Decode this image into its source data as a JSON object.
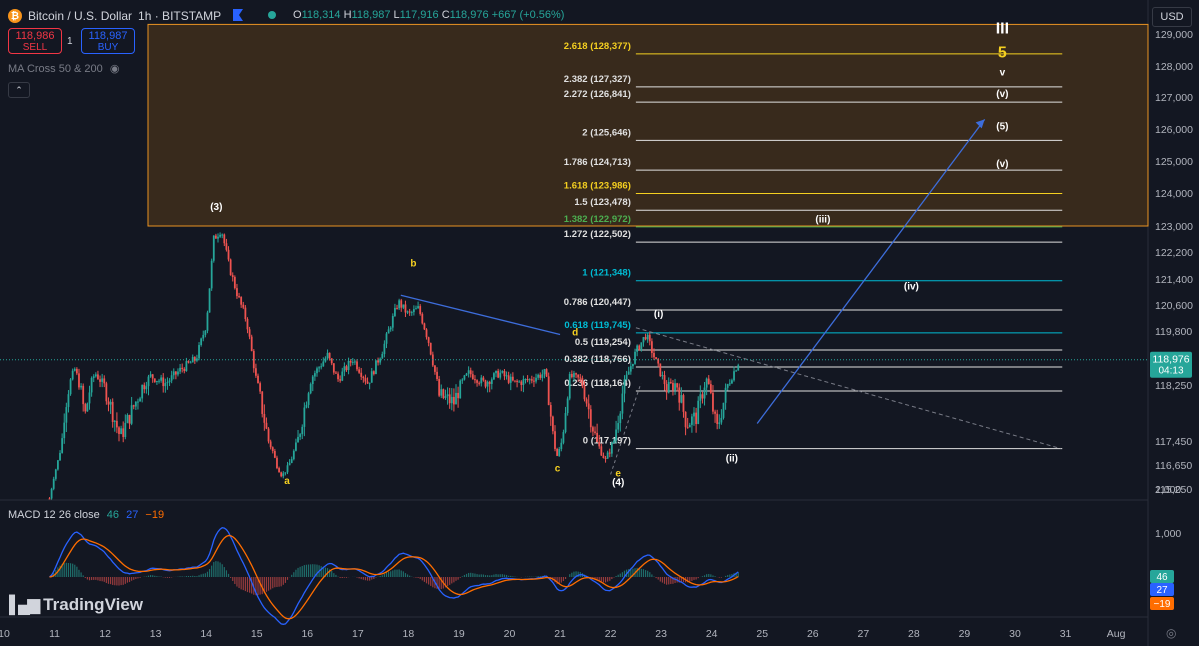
{
  "header": {
    "symbol": "Bitcoin / U.S. Dollar",
    "interval_exchange": "1h · BITSTAMP",
    "ohlc": [
      {
        "k": "O",
        "v": "118,314"
      },
      {
        "k": "H",
        "v": "118,987"
      },
      {
        "k": "L",
        "v": "117,916"
      },
      {
        "k": "C",
        "v": "118,976"
      }
    ],
    "change": "+667 (+0.56%)",
    "sell_price": "118,986",
    "sell_label": "SELL",
    "buy_price": "118,987",
    "buy_label": "BUY",
    "spread": "1",
    "indicator": "MA Cross 50 & 200",
    "macd_label": "MACD 12 26 close",
    "macd_values": [
      "46",
      "27",
      "−19"
    ],
    "currency": "USD",
    "logo": "TradingView",
    "icons": [
      "bitcoin-icon",
      "flag-icon",
      "status-dot-icon",
      "eye-icon",
      "collapse-icon",
      "gear-icon"
    ]
  },
  "colors": {
    "bg": "#131722",
    "up": "#26a69a",
    "down": "#ef5350",
    "fib_white": "#e0e0e0",
    "fib_yellow": "#f5d020",
    "fib_green": "#4caf50",
    "fib_cyan": "#00bcd4",
    "box": "#3a2c1c",
    "box_border": "#f59a23",
    "trend": "#3d6ddb",
    "macd": "#2962ff",
    "signal": "#ff6d00",
    "wave_yellow": "#f5d020"
  },
  "chart_data": {
    "type": "candlestick",
    "title": "Bitcoin / U.S. Dollar",
    "ylim": [
      114700,
      129300
    ],
    "y_ticks": [
      115250,
      116650,
      117450,
      118250,
      119800,
      120600,
      121400,
      122200,
      123000,
      124000,
      125000,
      126000,
      127000,
      128000,
      129000
    ],
    "x_ticks": [
      {
        "label": "10",
        "day": 10
      },
      {
        "label": "11",
        "day": 11
      },
      {
        "label": "12",
        "day": 12
      },
      {
        "label": "13",
        "day": 13
      },
      {
        "label": "14",
        "day": 14
      },
      {
        "label": "15",
        "day": 15
      },
      {
        "label": "16",
        "day": 16
      },
      {
        "label": "17",
        "day": 17
      },
      {
        "label": "18",
        "day": 18
      },
      {
        "label": "19",
        "day": 19
      },
      {
        "label": "20",
        "day": 20
      },
      {
        "label": "21",
        "day": 21
      },
      {
        "label": "22",
        "day": 22
      },
      {
        "label": "23",
        "day": 23
      },
      {
        "label": "24",
        "day": 24
      },
      {
        "label": "25",
        "day": 25
      },
      {
        "label": "26",
        "day": 26
      },
      {
        "label": "27",
        "day": 27
      },
      {
        "label": "28",
        "day": 28
      },
      {
        "label": "29",
        "day": 29
      },
      {
        "label": "30",
        "day": 30
      },
      {
        "label": "31",
        "day": 31
      },
      {
        "label": "Aug",
        "day": 32
      }
    ],
    "last_price": "118,976",
    "countdown": "04:13",
    "price_path": [
      [
        10.9,
        114700
      ],
      [
        11.0,
        116200
      ],
      [
        11.2,
        117900
      ],
      [
        11.4,
        118700
      ],
      [
        11.6,
        117800
      ],
      [
        11.8,
        118600
      ],
      [
        12.0,
        118200
      ],
      [
        12.3,
        117500
      ],
      [
        12.6,
        118000
      ],
      [
        12.9,
        118500
      ],
      [
        13.2,
        118300
      ],
      [
        13.5,
        118700
      ],
      [
        13.8,
        119000
      ],
      [
        14.0,
        120000
      ],
      [
        14.15,
        122600
      ],
      [
        14.3,
        122900
      ],
      [
        14.45,
        121800
      ],
      [
        14.6,
        121000
      ],
      [
        14.8,
        120100
      ],
      [
        15.0,
        118300
      ],
      [
        15.3,
        117200
      ],
      [
        15.5,
        116000
      ],
      [
        15.8,
        117400
      ],
      [
        16.1,
        118500
      ],
      [
        16.4,
        119100
      ],
      [
        16.6,
        118400
      ],
      [
        16.9,
        119000
      ],
      [
        17.2,
        118300
      ],
      [
        17.5,
        119300
      ],
      [
        17.8,
        120700
      ],
      [
        18.0,
        120300
      ],
      [
        18.2,
        120500
      ],
      [
        18.4,
        119500
      ],
      [
        18.6,
        118100
      ],
      [
        18.9,
        118000
      ],
      [
        19.2,
        118600
      ],
      [
        19.5,
        118300
      ],
      [
        19.8,
        118600
      ],
      [
        20.1,
        118300
      ],
      [
        20.4,
        118400
      ],
      [
        20.7,
        118600
      ],
      [
        20.95,
        116900
      ],
      [
        21.2,
        118500
      ],
      [
        21.4,
        118400
      ],
      [
        21.7,
        117500
      ],
      [
        21.9,
        116800
      ],
      [
        22.1,
        117600
      ],
      [
        22.3,
        118400
      ],
      [
        22.5,
        119200
      ],
      [
        22.7,
        119700
      ],
      [
        22.9,
        118900
      ],
      [
        23.1,
        118200
      ],
      [
        23.3,
        118300
      ],
      [
        23.5,
        117700
      ],
      [
        23.7,
        117800
      ],
      [
        23.9,
        118400
      ],
      [
        24.1,
        117600
      ],
      [
        24.3,
        118200
      ],
      [
        24.55,
        118976
      ]
    ],
    "fib_levels": [
      {
        "label": "2.618 (128,377)",
        "value": 128377,
        "color": "yellow"
      },
      {
        "label": "2.382 (127,327)",
        "value": 127327,
        "color": "white"
      },
      {
        "label": "2.272 (126,841)",
        "value": 126841,
        "color": "white"
      },
      {
        "label": "2 (125,646)",
        "value": 125646,
        "color": "white"
      },
      {
        "label": "1.786 (124,713)",
        "value": 124713,
        "color": "white"
      },
      {
        "label": "1.618 (123,986)",
        "value": 123986,
        "color": "yellow"
      },
      {
        "label": "1.5 (123,478)",
        "value": 123478,
        "color": "white"
      },
      {
        "label": "1.382 (122,972)",
        "value": 122972,
        "color": "green"
      },
      {
        "label": "1.272 (122,502)",
        "value": 122502,
        "color": "white"
      },
      {
        "label": "1 (121,348)",
        "value": 121348,
        "color": "cyan"
      },
      {
        "label": "0.786 (120,447)",
        "value": 120447,
        "color": "white"
      },
      {
        "label": "0.618 (119,745)",
        "value": 119745,
        "color": "cyan"
      },
      {
        "label": "0.5 (119,254)",
        "value": 119254,
        "color": "white"
      },
      {
        "label": "0.382 (118,766)",
        "value": 118766,
        "color": "white"
      },
      {
        "label": "0.236 (118,164)",
        "value": 118164,
        "color": "white"
      },
      {
        "label": "0 (117,197)",
        "value": 117197,
        "color": "white"
      }
    ],
    "wave_labels": [
      {
        "text": "(3)",
        "day": 14.2,
        "price": 123480,
        "color": "white"
      },
      {
        "text": "a",
        "day": 15.6,
        "price": 115540,
        "color": "yellow"
      },
      {
        "text": "b",
        "day": 18.1,
        "price": 121770,
        "color": "yellow"
      },
      {
        "text": "c",
        "day": 20.95,
        "price": 116280,
        "color": "yellow"
      },
      {
        "text": "d",
        "day": 21.3,
        "price": 119670,
        "color": "yellow"
      },
      {
        "text": "e",
        "day": 22.15,
        "price": 115990,
        "color": "yellow"
      },
      {
        "text": "(4)",
        "day": 22.15,
        "price": 115440,
        "color": "white"
      },
      {
        "text": "(i)",
        "day": 22.95,
        "price": 120230,
        "color": "white"
      },
      {
        "text": "(ii)",
        "day": 24.4,
        "price": 116770,
        "color": "white"
      },
      {
        "text": "(iii)",
        "day": 26.2,
        "price": 123100,
        "color": "white"
      },
      {
        "text": "(iv)",
        "day": 27.95,
        "price": 121080,
        "color": "white"
      },
      {
        "text": "(v)",
        "day": 29.75,
        "price": 124810,
        "color": "white"
      },
      {
        "text": "(5)",
        "day": 29.75,
        "price": 125990,
        "color": "white"
      },
      {
        "text": "(v)",
        "day": 29.75,
        "price": 127000,
        "color": "white"
      },
      {
        "text": "v",
        "day": 29.75,
        "price": 127700,
        "color": "white"
      },
      {
        "text": "5",
        "day": 29.75,
        "price": 128270,
        "color": "yellow"
      },
      {
        "text": "III",
        "day": 29.75,
        "price": 129010,
        "color": "white"
      }
    ],
    "macd": {
      "yticks": [
        {
          "label": "2,000",
          "value": 2000
        },
        {
          "label": "1,000",
          "value": 1000
        }
      ],
      "ylim": [
        -1800,
        2100
      ],
      "last": {
        "macd": "46",
        "signal": "27",
        "hist": "−19"
      }
    }
  }
}
